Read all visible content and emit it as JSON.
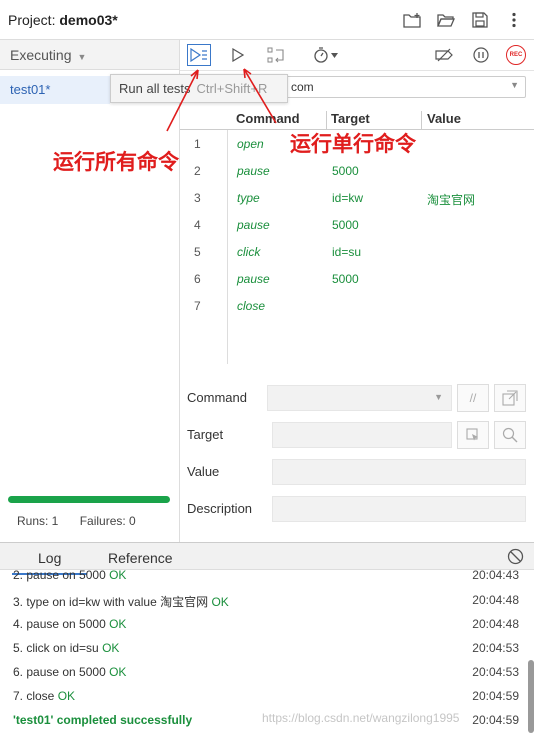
{
  "project": {
    "label": "Project:",
    "name": "demo03*"
  },
  "sidebar": {
    "header": "Executing",
    "tests": [
      {
        "label": "test01*"
      }
    ],
    "runs_label": "Runs: 1",
    "failures_label": "Failures: 0",
    "progress": 1.0
  },
  "tooltip": {
    "text": "Run all tests",
    "shortcut": "Ctrl+Shift+R"
  },
  "url": {
    "value": "com"
  },
  "table": {
    "headers": [
      "Command",
      "Target",
      "Value"
    ],
    "rows": [
      {
        "num": "1",
        "command": "open",
        "target": "",
        "value": ""
      },
      {
        "num": "2",
        "command": "pause",
        "target": "5000",
        "value": ""
      },
      {
        "num": "3",
        "command": "type",
        "target": "id=kw",
        "value": "淘宝官网"
      },
      {
        "num": "4",
        "command": "pause",
        "target": "5000",
        "value": ""
      },
      {
        "num": "5",
        "command": "click",
        "target": "id=su",
        "value": ""
      },
      {
        "num": "6",
        "command": "pause",
        "target": "5000",
        "value": ""
      },
      {
        "num": "7",
        "command": "close",
        "target": "",
        "value": ""
      }
    ]
  },
  "annotations": {
    "run_all": "运行所有命令",
    "run_single": "运行单行命令"
  },
  "form": {
    "command_label": "Command",
    "target_label": "Target",
    "value_label": "Value",
    "description_label": "Description",
    "comment_button": "//"
  },
  "log_tabs": {
    "log": "Log",
    "reference": "Reference"
  },
  "log": [
    {
      "text": "2.  pause on 5000",
      "ok": "OK",
      "time": "20:04:43"
    },
    {
      "text": "3.  type on id=kw with value 淘宝官网",
      "ok": "OK",
      "time": "20:04:48"
    },
    {
      "text": "4.  pause on 5000",
      "ok": "OK",
      "time": "20:04:48"
    },
    {
      "text": "5.  click on id=su",
      "ok": "OK",
      "time": "20:04:53"
    },
    {
      "text": "6.  pause on 5000",
      "ok": "OK",
      "time": "20:04:53"
    },
    {
      "text": "7.  close",
      "ok": "OK",
      "time": "20:04:59"
    },
    {
      "text": "'test01' completed successfully",
      "ok": "",
      "time": "20:04:59"
    }
  ],
  "watermark": "https://blog.csdn.net/wangzilong1995",
  "icons": [
    "new-folder-icon",
    "open-folder-icon",
    "save-icon",
    "more-vertical-icon",
    "run-all-icon",
    "run-single-icon",
    "step-icon",
    "speed-icon",
    "disable-breakpoints-icon",
    "pause-icon",
    "record-icon",
    "clear-icon",
    "select-target-icon",
    "search-icon",
    "new-window-icon"
  ],
  "colors": {
    "accent": "#3a78c9",
    "success": "#1a8f3c",
    "annotation": "#e01d1d",
    "record": "#e02626"
  }
}
